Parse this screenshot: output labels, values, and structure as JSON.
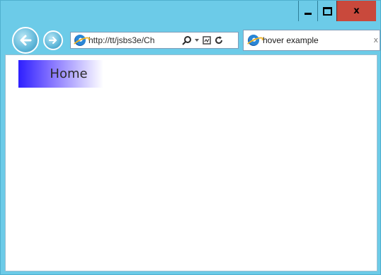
{
  "window": {
    "caption_buttons": {
      "minimize_icon": "minimize-icon",
      "maximize_icon": "maximize-icon",
      "close_label": "x"
    }
  },
  "toolbar": {
    "back_icon": "back-arrow-icon",
    "forward_icon": "forward-arrow-icon",
    "address": {
      "url": "http://tt/jsbs3e/Ch",
      "search_icon": "search-icon",
      "dropdown_icon": "dropdown-icon",
      "compat_icon": "compatibility-view-icon",
      "refresh_icon": "refresh-icon"
    },
    "tab": {
      "title": "hover example",
      "close_label": "x"
    }
  },
  "page": {
    "nav": {
      "home_label": "Home"
    }
  },
  "colors": {
    "chrome": "#6ccbe8",
    "close": "#c9493c",
    "link_gradient_start": "#2d1fff",
    "link_gradient_end": "#ffffff"
  }
}
